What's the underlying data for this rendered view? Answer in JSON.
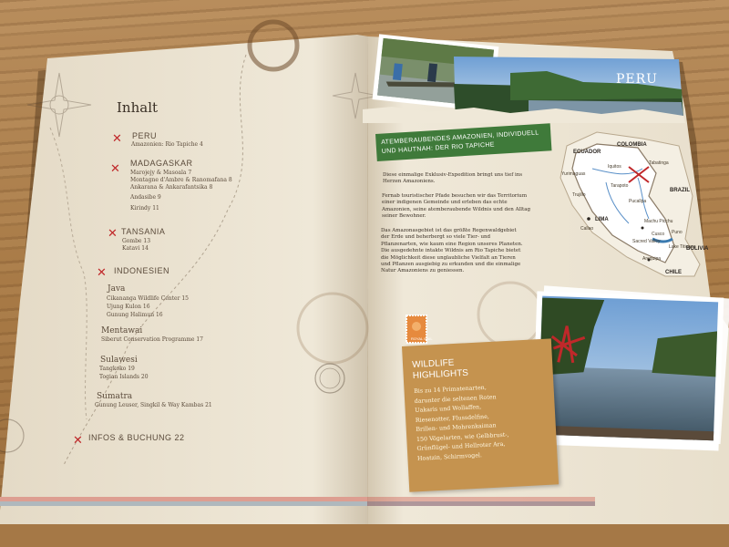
{
  "toc": {
    "title": "Inhalt",
    "sections": [
      {
        "heading": "PERU",
        "items": [
          "Amazonien: Rio Tapiche 4"
        ]
      },
      {
        "heading": "MADAGASKAR",
        "items": [
          "Marojejy & Masoala 7",
          "Montagne d'Ambre & Ranomafana 8",
          "Ankarana & Ankarafantsika 8",
          "Andasibe 9",
          "Kirindy 11"
        ]
      },
      {
        "heading": "TANSANIA",
        "items": [
          "Gombe 13",
          "Katavi 14"
        ]
      },
      {
        "heading": "INDONESIEN",
        "items": []
      }
    ],
    "indonesia_groups": [
      {
        "name": "Java",
        "items": [
          "Cikananga Wildlife Center 15",
          "Ujung Kulon 16",
          "Gunung Halimun 16"
        ]
      },
      {
        "name": "Mentawai",
        "items": [
          "Siberut Conservation Programme 17"
        ]
      },
      {
        "name": "Sulawesi",
        "items": [
          "Tangkoko 19",
          "Togian Islands 20"
        ]
      },
      {
        "name": "Sumatra",
        "items": [
          "Gunung Leuser, Singkil & Way Kambas 21"
        ]
      }
    ],
    "final": "INFOS & BUCHUNG 22"
  },
  "right_page": {
    "country": "PERU",
    "banner": [
      "ATEMBERAUBENDES AMAZONIEN, INDIVIDUELL",
      "UND HAUTNAH: DER RIO TAPICHE"
    ],
    "paragraphs": [
      [
        "Diese einmalige Exklusiv-Expedition bringt uns tief ins",
        "Herzen Amazoniens."
      ],
      [
        "Fernab touristischer Pfade besuchen wir das Territorium",
        "einer indigenen Gemeinde und erleben das echte",
        "Amazonien, seine atemberaubende Wildnis und den Alltag",
        "seiner Bewohner."
      ],
      [
        "Das Amazonasgebiet ist das größte Regenwaldgebiet",
        "der Erde und beherbergt so viele Tier- und",
        "Pflanzenarten, wie kaum eine Region unseres Planeten.",
        "Die ausgedehnte intakte Wildnis am Rio Tapiche bietet",
        "die Möglichkeit diese unglaubliche Vielfalt an Tieren",
        "und Pflanzen ausgiebig zu erkunden und die einmalige",
        "Natur Amazoniens zu geniessen."
      ]
    ],
    "wildlife": {
      "title": [
        "WILDLIFE",
        "HIGHLIGHTS"
      ],
      "lines": [
        "Bis zu 14 Primatenarten,",
        "darunter die seltenen Roten",
        "Uakaris und Wollaffen,",
        "Riesenotter, Flussdelfine,",
        "Brillen- und Mohrenkaiman",
        "150 Vögelarten, wie Gelbbrust-,",
        "Grünflügel- und Hellroter Ara,",
        "Hoatzin, Schirmvogel."
      ]
    },
    "map": {
      "labels": [
        "ECUADOR",
        "COLOMBIA",
        "BRAZIL",
        "Tabatinga",
        "Iquitos",
        "Yurimaguas",
        "Tarapoto",
        "Trujillo",
        "Pucallpa",
        "LIMA",
        "Callao",
        "Machu Picchu",
        "Cusco",
        "Sacred Valley",
        "Puno",
        "Lake Titicaca",
        "Arequipa",
        "BOLIVIA",
        "CHILE"
      ]
    },
    "stamp_text": "ROYAL MAIL"
  },
  "colors": {
    "accent_red": "#c0282a",
    "banner_green": "#3f7a3a",
    "card_tan": "#c5934f",
    "paper": "#ece3d2"
  }
}
